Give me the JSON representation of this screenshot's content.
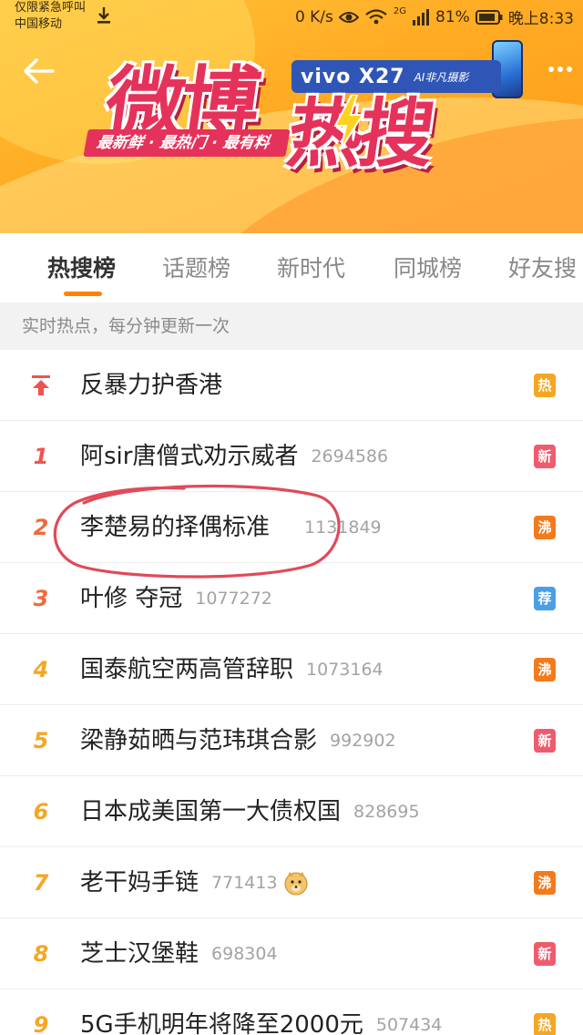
{
  "status_bar": {
    "carrier_line1": "仅限紧急呼叫",
    "carrier_line2": "中国移动",
    "net_speed": "0 K/s",
    "network_type": "2G",
    "battery": "81%",
    "time": "晚上8:33",
    "icons": [
      "download-icon",
      "eye-icon",
      "wifi-icon",
      "signal-icon",
      "battery-icon"
    ]
  },
  "banner": {
    "logo_line1": "微博",
    "logo_line2": "热搜",
    "slogan": "最新鲜 · 最热门 · 最有料",
    "ad_brand": "vivo X27",
    "ad_tagline": "AI非凡摄影",
    "colors": {
      "background": "#ffab23",
      "logo": "#e5325a",
      "ad": "#2f56b7"
    }
  },
  "tabs": [
    {
      "label": "热搜榜",
      "active": true
    },
    {
      "label": "话题榜",
      "active": false
    },
    {
      "label": "新时代",
      "active": false
    },
    {
      "label": "同城榜",
      "active": false
    },
    {
      "label": "好友搜",
      "active": false
    }
  ],
  "notice": "实时热点，每分钟更新一次",
  "hot_list": [
    {
      "rank": "",
      "pinned": true,
      "title": "反暴力护香港",
      "count": "",
      "badge": "热",
      "badge_color": "#f5a623",
      "rank_color": "#ef5350"
    },
    {
      "rank": "1",
      "pinned": false,
      "title": "阿sir唐僧式劝示威者",
      "count": "2694586",
      "badge": "新",
      "badge_color": "#ef5b6e",
      "rank_color": "#ef5350"
    },
    {
      "rank": "2",
      "pinned": false,
      "title": "李楚易的择偶标准",
      "count": "1131849",
      "badge": "沸",
      "badge_color": "#f37b1d",
      "rank_color": "#f06a3a"
    },
    {
      "rank": "3",
      "pinned": false,
      "title": "叶修 夺冠",
      "count": "1077272",
      "badge": "荐",
      "badge_color": "#4a9fe6",
      "rank_color": "#f26a3a"
    },
    {
      "rank": "4",
      "pinned": false,
      "title": "国泰航空两高管辞职",
      "count": "1073164",
      "badge": "沸",
      "badge_color": "#f37b1d",
      "rank_color": "#f5a623"
    },
    {
      "rank": "5",
      "pinned": false,
      "title": "梁静茹晒与范玮琪合影",
      "count": "992902",
      "badge": "新",
      "badge_color": "#ef5b6e",
      "rank_color": "#f5a623"
    },
    {
      "rank": "6",
      "pinned": false,
      "title": "日本成美国第一大债权国",
      "count": "828695",
      "badge": "",
      "badge_color": "",
      "rank_color": "#f5a623"
    },
    {
      "rank": "7",
      "pinned": false,
      "title": "老干妈手链",
      "count": "771413",
      "emoji": "doge-emoji-icon",
      "badge": "沸",
      "badge_color": "#f37b1d",
      "rank_color": "#f5a623"
    },
    {
      "rank": "8",
      "pinned": false,
      "title": "芝士汉堡鞋",
      "count": "698304",
      "badge": "新",
      "badge_color": "#ef5b6e",
      "rank_color": "#f5a623"
    },
    {
      "rank": "9",
      "pinned": false,
      "title": "5G手机明年将降至2000元",
      "count": "507434",
      "badge": "热",
      "badge_color": "#f5a623",
      "rank_color": "#f5a623"
    }
  ]
}
